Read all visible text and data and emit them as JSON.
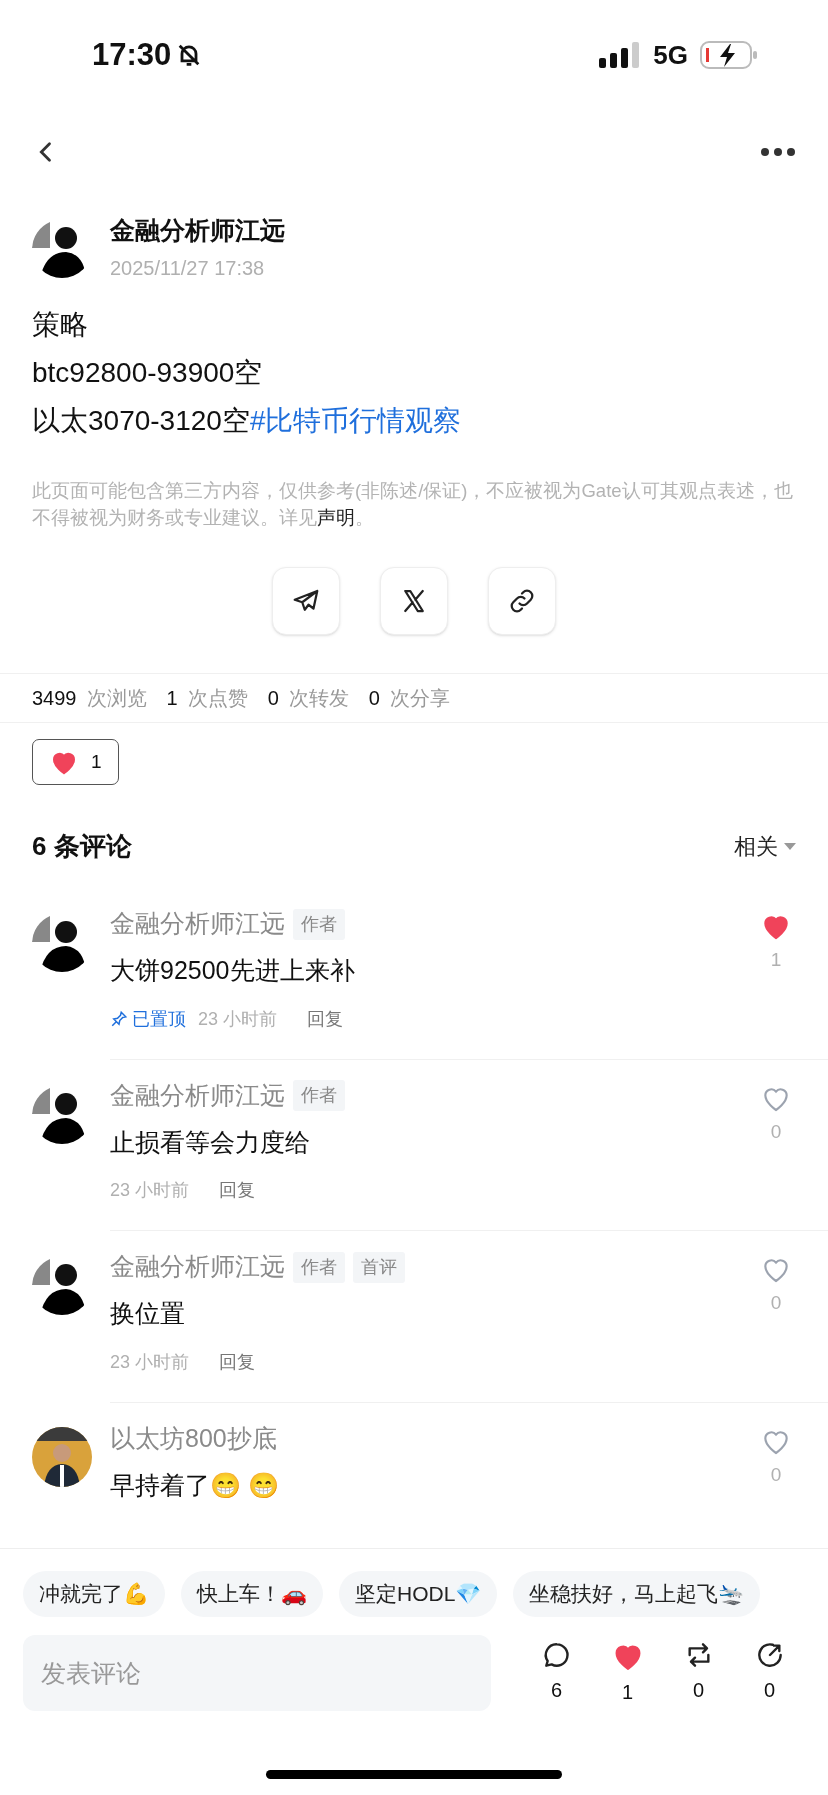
{
  "status_bar": {
    "time": "17:30",
    "network": "5G",
    "muted": true
  },
  "post": {
    "author": "金融分析师江远",
    "date": "2025/11/27 17:38",
    "lines": [
      "策略",
      "btc92800-93900空",
      "以太3070-3120空"
    ],
    "hashtag": "#比特币行情观察",
    "disclaimer": "此页面可能包含第三方内容，仅供参考(非陈述/保证)，不应被视为Gate认可其观点表述，也不得被视为财务或专业建议。详见",
    "disclaimer_link": "声明",
    "disclaimer_end": "。"
  },
  "share_buttons": [
    {
      "kind": "telegram"
    },
    {
      "kind": "x"
    },
    {
      "kind": "link"
    }
  ],
  "stats": [
    {
      "count": "3499",
      "label": "次浏览"
    },
    {
      "count": "1",
      "label": "次点赞"
    },
    {
      "count": "0",
      "label": "次转发"
    },
    {
      "count": "0",
      "label": "次分享"
    }
  ],
  "reaction": {
    "count": "1",
    "liked": true
  },
  "comments_header": {
    "title": "6 条评论",
    "sort": "相关"
  },
  "comments": [
    {
      "author": "金融分析师江远",
      "tags": [
        "作者"
      ],
      "text": "大饼92500先进上来补",
      "pinned": "已置顶",
      "time": "23 小时前",
      "reply": "回复",
      "liked": true,
      "likes": "1"
    },
    {
      "author": "金融分析师江远",
      "tags": [
        "作者"
      ],
      "text": "止损看等会力度给",
      "time": "23 小时前",
      "reply": "回复",
      "liked": false,
      "likes": "0"
    },
    {
      "author": "金融分析师江远",
      "tags": [
        "作者",
        "首评"
      ],
      "text": "换位置",
      "time": "23 小时前",
      "reply": "回复",
      "liked": false,
      "likes": "0"
    },
    {
      "author": "以太坊800抄底",
      "text": "早持着了😁 😁",
      "liked": false,
      "likes": "0"
    }
  ],
  "quick_replies": [
    "冲就完了💪",
    "快上车！🚗",
    "坚定HODL💎",
    "坐稳扶好，马上起飞🛬"
  ],
  "composer": {
    "placeholder": "发表评论"
  },
  "actions": [
    {
      "kind": "comment",
      "count": "6",
      "active": false
    },
    {
      "kind": "like",
      "count": "1",
      "active": true
    },
    {
      "kind": "repost",
      "count": "0",
      "active": false
    },
    {
      "kind": "share",
      "count": "0",
      "active": false
    }
  ]
}
